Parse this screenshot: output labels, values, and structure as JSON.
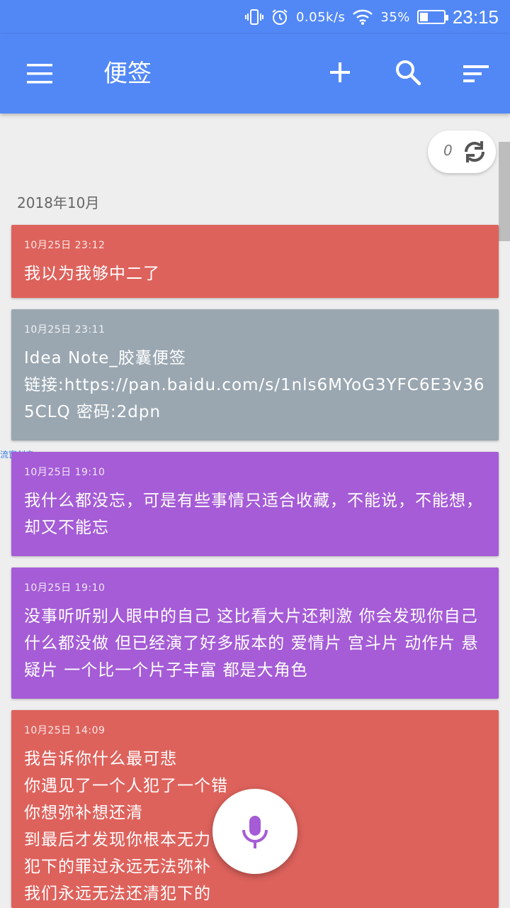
{
  "status_bar": {
    "network_speed": "0.05k/s",
    "battery_percent": "35%",
    "battery_level": 0.35,
    "time": "23:15",
    "icons": [
      "vibrate-icon",
      "alarm-icon",
      "wifi-icon",
      "battery-icon"
    ]
  },
  "app_bar": {
    "title": "便签",
    "icons": [
      "menu-icon",
      "add-icon",
      "search-icon",
      "sort-icon"
    ]
  },
  "sync": {
    "count": "0"
  },
  "month_header": "2018年10月",
  "floating_label": "流窗创启",
  "notes": [
    {
      "date": "10月25日 23:12",
      "text": "我以为我够中二了",
      "color": "#de625c"
    },
    {
      "date": "10月25日 23:11",
      "text": "Idea Note_胶囊便签\n链接:https://pan.baidu.com/s/1nls6MYoG3YFC6E3v365CLQ 密码:2dpn",
      "color": "#9aa7b1"
    },
    {
      "date": "10月25日 19:10",
      "text": "我什么都没忘，可是有些事情只适合收藏，不能说，不能想，却又不能忘",
      "color": "#a55cd6"
    },
    {
      "date": "10月25日 19:10",
      "text": "没事听听别人眼中的自己 这比看大片还刺激 你会发现你自己什么都没做 但已经演了好多版本的 爱情片 宫斗片 动作片 悬疑片 一个比一个片子丰富 都是大角色",
      "color": "#a55cd6"
    },
    {
      "date": "10月25日 14:09",
      "text": "我告诉你什么最可悲\n你遇见了一个人犯了一个错\n你想弥补想还清\n到最后才发现你根本无力\n犯下的罪过永远无法弥补\n我们永远无法还清犯下的",
      "color": "#de625c"
    }
  ],
  "fab": {
    "icon": "microphone-icon",
    "accent": "#a55cd6"
  }
}
